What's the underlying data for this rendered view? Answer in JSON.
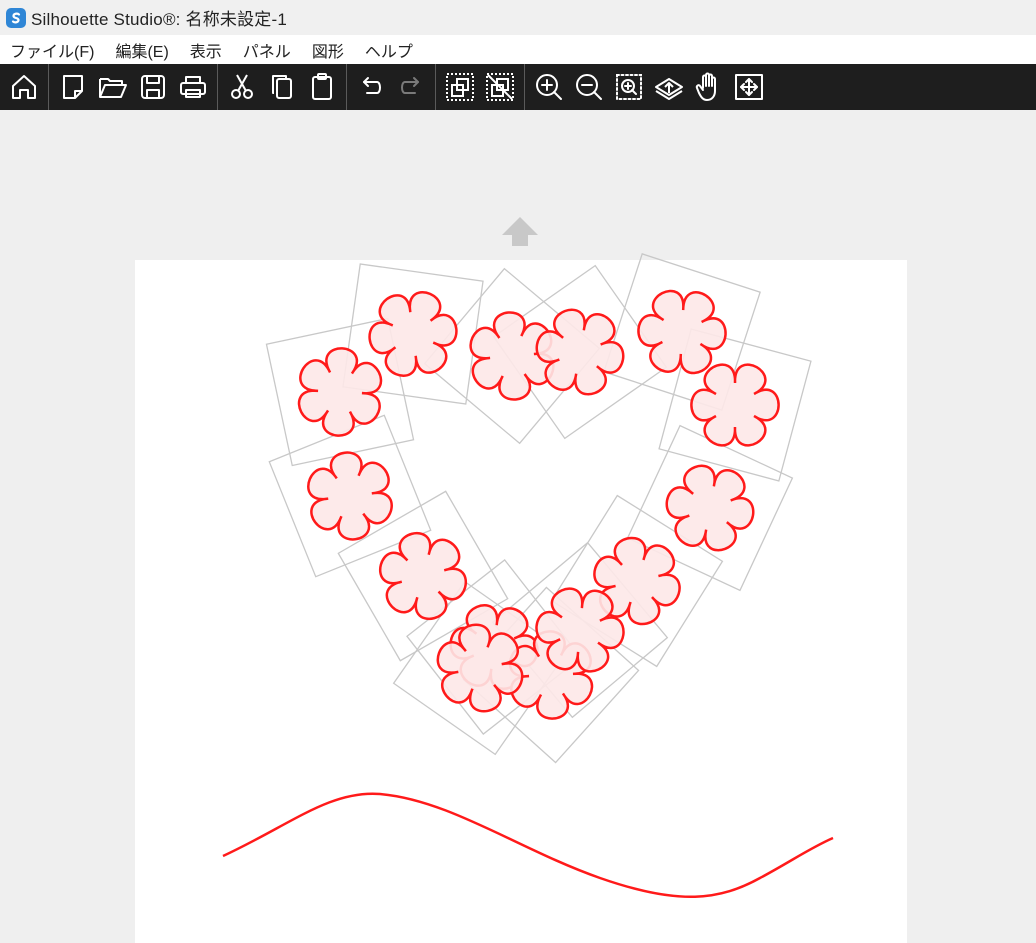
{
  "window": {
    "title": "Silhouette Studio®: 名称未設定-1"
  },
  "menu": {
    "items": [
      {
        "name": "menu-file",
        "label": "ファイル(F)"
      },
      {
        "name": "menu-edit",
        "label": "編集(E)"
      },
      {
        "name": "menu-view",
        "label": "表示"
      },
      {
        "name": "menu-panel",
        "label": "パネル"
      },
      {
        "name": "menu-shape",
        "label": "図形"
      },
      {
        "name": "menu-help",
        "label": "ヘルプ"
      }
    ]
  },
  "toolbar": {
    "groups": [
      [
        "home-icon"
      ],
      [
        "new-document-icon",
        "open-folder-icon",
        "save-icon",
        "print-icon"
      ],
      [
        "cut-icon",
        "copy-icon",
        "paste-icon"
      ],
      [
        "undo-icon",
        "redo-icon"
      ],
      [
        "group-icon",
        "ungroup-icon"
      ],
      [
        "zoom-in-icon",
        "zoom-out-icon",
        "zoom-selection-icon",
        "zoom-fit-page-icon",
        "pan-hand-icon",
        "fit-to-window-icon"
      ]
    ],
    "disabled": [
      "redo-icon"
    ]
  },
  "design": {
    "shape_stroke": "#ff1a1a",
    "shape_fill": "#fde8e8",
    "selection_box_color": "#c8c8c8",
    "flower_count": 14,
    "petal_count": 6,
    "wave_line": "present"
  },
  "colors": {
    "toolbar_bg": "#1e1e1e",
    "icon": "#ffffff",
    "icon_disabled": "#7a7a7a",
    "canvas_bg": "#efefef",
    "page_bg": "#ffffff",
    "app_icon": "#2f86d6"
  }
}
